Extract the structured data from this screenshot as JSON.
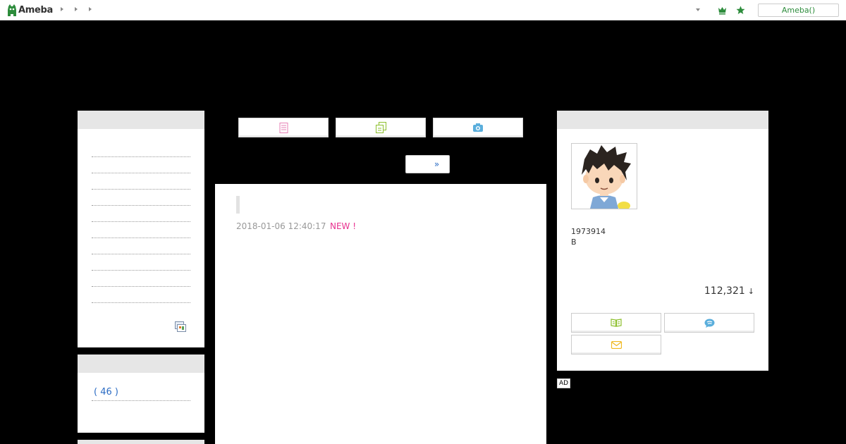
{
  "header": {
    "logo_text": "Ameba",
    "ameba_button": "Ameba()"
  },
  "icons": {
    "crown": "crown-icon",
    "star": "star-icon",
    "article": "article-icon",
    "copy": "copy-icon",
    "camera": "camera-icon",
    "book": "book-icon",
    "chat": "chat-icon",
    "mail": "mail-icon",
    "rss": "rss-feed-icon"
  },
  "colors": {
    "brand_green": "#2d8c3c",
    "link_blue": "#2b6cc4",
    "new_pink": "#e8318f"
  },
  "sidebar": {
    "category_count": "( 46 )"
  },
  "pager": {
    "next_label": "»"
  },
  "article": {
    "date": "2018-01-06 12:40:17",
    "new_badge": "NEW !"
  },
  "profile": {
    "id": "1973914",
    "type": "B",
    "followers": "112,321",
    "followers_arrow": "↓"
  },
  "ad": {
    "label": "AD"
  }
}
